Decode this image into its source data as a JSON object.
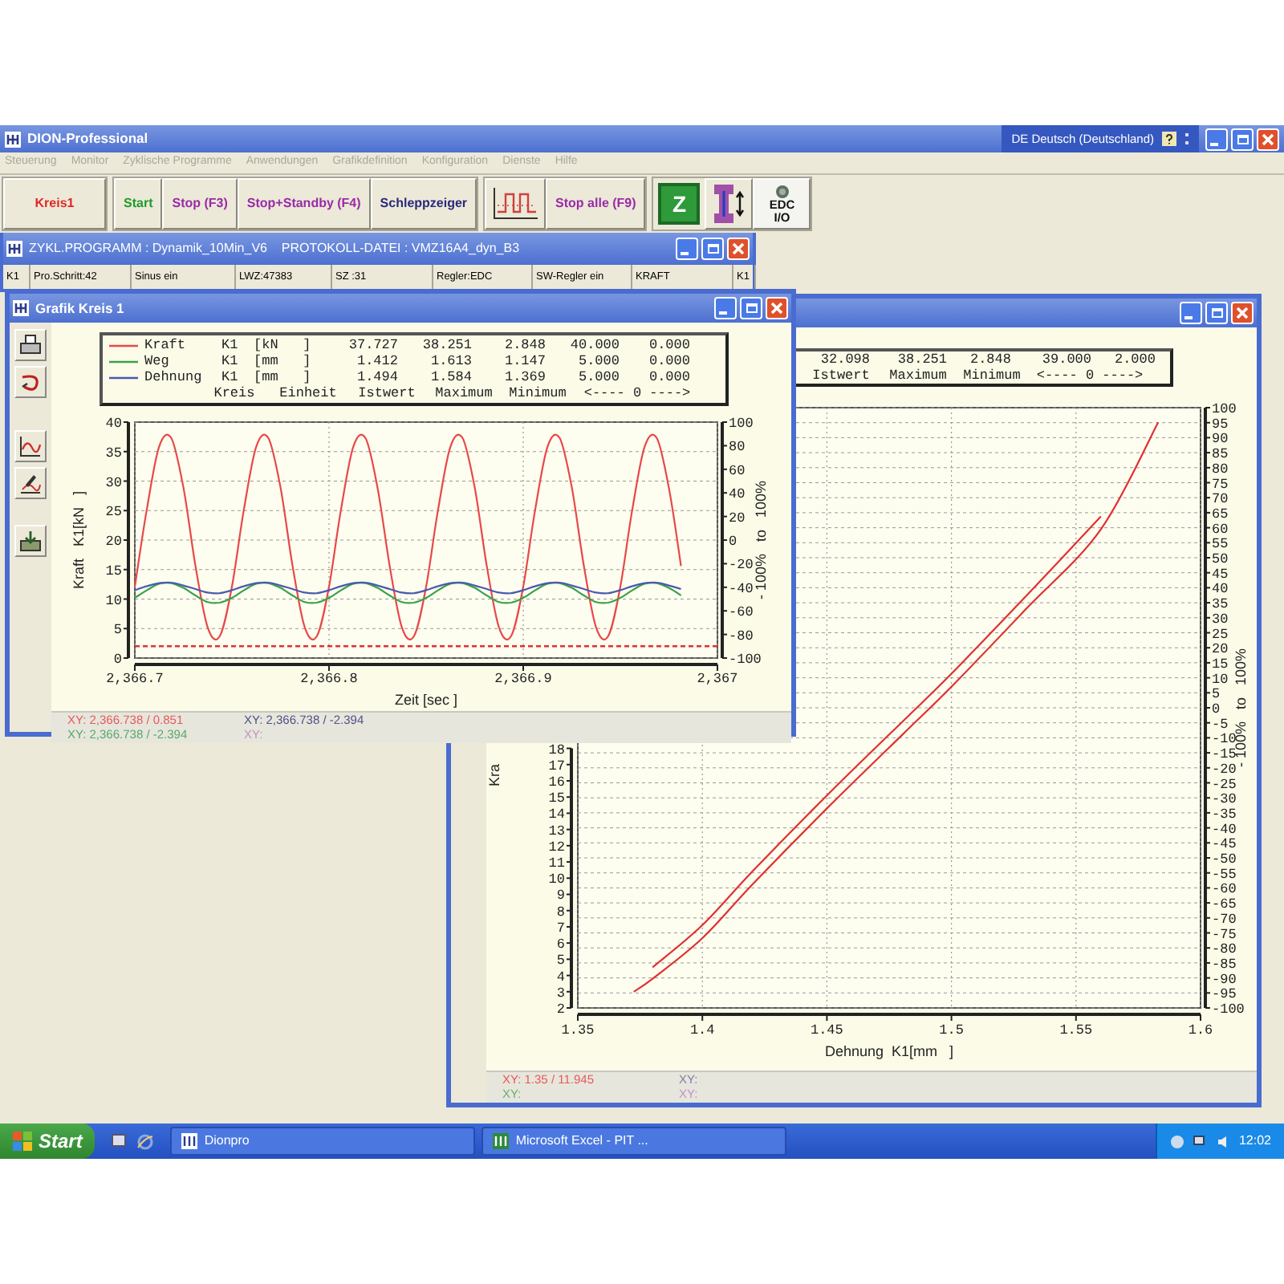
{
  "app": {
    "title": "DION-Professional",
    "language": "DE Deutsch (Deutschland)"
  },
  "menu": [
    "Steuerung",
    "Monitor",
    "Zyklische Programme",
    "Anwendungen",
    "Grafikdefinition",
    "Konfiguration",
    "Dienste",
    "Hilfe"
  ],
  "toolbar": [
    {
      "buttons": [
        {
          "kind": "text",
          "label": "Kreis1",
          "color": "#e02828"
        }
      ]
    },
    {
      "buttons": [
        {
          "kind": "text",
          "label": "Start",
          "color": "#1e9a2e"
        },
        {
          "kind": "text",
          "label": "Stop (F3)",
          "color": "#9a2aa8"
        },
        {
          "kind": "text",
          "label": "Stop+Standby (F4)",
          "color": "#9a2aa8"
        },
        {
          "kind": "text",
          "label": "Schleppzeiger",
          "color": "#2a2a7a"
        }
      ]
    },
    {
      "buttons": [
        {
          "kind": "chart"
        },
        {
          "kind": "text",
          "label": "Stop alle (F9)",
          "color": "#9a2aa8"
        }
      ]
    },
    {
      "buttons": [
        {
          "kind": "tile",
          "label": "Z"
        },
        {
          "kind": "specimen"
        },
        {
          "kind": "io",
          "label": "EDC I/O"
        }
      ]
    }
  ],
  "program_window": {
    "title": "ZYKL.PROGRAMM : Dynamik_10Min_V6    PROTOKOLL-DATEI : VMZ16A4_dyn_B3",
    "cells": [
      "K1",
      "Pro.Schritt:42",
      "Sinus ein",
      "LWZ:47383",
      "SZ :31",
      "Regler:EDC",
      "SW-Regler ein",
      "KRAFT",
      "K1"
    ]
  },
  "grafik_window": {
    "title": "Grafik Kreis 1",
    "legend": {
      "rows": [
        {
          "name": "Kraft",
          "circuit": "K1",
          "unit": "[kN   ]",
          "values": [
            "37.727",
            "38.251",
            "2.848",
            "40.000",
            "0.000"
          ],
          "color": "#e84848"
        },
        {
          "name": "Weg",
          "circuit": "K1",
          "unit": "[mm   ]",
          "values": [
            "1.412",
            "1.613",
            "1.147",
            "5.000",
            "0.000"
          ],
          "color": "#3aa048"
        },
        {
          "name": "Dehnung",
          "circuit": "K1",
          "unit": "[mm   ]",
          "values": [
            "1.494",
            "1.584",
            "1.369",
            "5.000",
            "0.000"
          ],
          "color": "#4a5ab0"
        }
      ],
      "footer": [
        "Kreis",
        "Einheit",
        "Istwert",
        "Maximum",
        "Minimum",
        "<---- 0 ---->"
      ]
    },
    "chart_data": {
      "type": "line",
      "xlabel": "Zeit [sec ]",
      "ylabel": "Kraft   K1[kN   ]",
      "y2label": "- 100%   to   100%",
      "grid": "both",
      "x": [
        2366.7,
        2366.70625,
        2366.7125,
        2366.71875,
        2366.725,
        2366.73125,
        2366.7375,
        2366.74375,
        2366.75,
        2366.75625,
        2366.7625,
        2366.76875,
        2366.775,
        2366.78125,
        2366.7875,
        2366.79375,
        2366.8,
        2366.80625,
        2366.8125,
        2366.81875,
        2366.825,
        2366.83125,
        2366.8375,
        2366.84375,
        2366.85,
        2366.85625,
        2366.8625,
        2366.86875,
        2366.875,
        2366.88125,
        2366.8875,
        2366.89375,
        2366.9,
        2366.90625,
        2366.9125,
        2366.91875,
        2366.925,
        2366.93125,
        2366.9375,
        2366.94375,
        2366.95,
        2366.95625,
        2366.9625,
        2366.96875,
        2366.975,
        2366.98125
      ],
      "series": [
        {
          "color": "#e84848",
          "values": [
            12.1,
            25.4,
            35.8,
            37.3,
            28.9,
            15.6,
            5.2,
            3.7,
            12.1,
            25.4,
            35.8,
            37.3,
            28.9,
            15.6,
            5.2,
            3.7,
            12.1,
            25.4,
            35.8,
            37.3,
            28.9,
            15.6,
            5.2,
            3.7,
            12.1,
            25.4,
            35.8,
            37.3,
            28.9,
            15.6,
            5.2,
            3.7,
            12.1,
            25.4,
            35.8,
            37.3,
            28.9,
            15.6,
            5.2,
            3.7,
            12.1,
            25.4,
            35.8,
            37.3,
            28.9,
            15.6
          ]
        },
        {
          "color": "#3aa048",
          "values": [
            10.2,
            11.5,
            12.6,
            12.7,
            11.9,
            10.6,
            9.5,
            9.4,
            10.2,
            11.5,
            12.6,
            12.7,
            11.9,
            10.6,
            9.5,
            9.4,
            10.2,
            11.5,
            12.6,
            12.7,
            11.9,
            10.6,
            9.5,
            9.4,
            10.2,
            11.5,
            12.6,
            12.7,
            11.9,
            10.6,
            9.5,
            9.4,
            10.2,
            11.5,
            12.6,
            12.7,
            11.9,
            10.6,
            9.5,
            9.4,
            10.2,
            11.5,
            12.6,
            12.7,
            11.9,
            10.6
          ]
        },
        {
          "color": "#4a5ab0",
          "values": [
            11.5,
            12.2,
            12.7,
            12.8,
            12.3,
            11.7,
            11.1,
            11.0,
            11.5,
            12.2,
            12.7,
            12.8,
            12.3,
            11.7,
            11.1,
            11.0,
            11.5,
            12.2,
            12.7,
            12.8,
            12.3,
            11.7,
            11.1,
            11.0,
            11.5,
            12.2,
            12.7,
            12.8,
            12.3,
            11.7,
            11.1,
            11.0,
            11.5,
            12.2,
            12.7,
            12.8,
            12.3,
            11.7,
            11.1,
            11.0,
            11.5,
            12.2,
            12.7,
            12.8,
            12.3,
            11.7
          ]
        }
      ],
      "xlim": [
        2366.7,
        2367
      ],
      "ylim": [
        0,
        40
      ],
      "y2lim": [
        -100,
        100
      ],
      "xticks": [
        {
          "value": 2366.7,
          "label": "2,366.7"
        },
        {
          "value": 2366.8,
          "label": "2,366.8"
        },
        {
          "value": 2366.9,
          "label": "2,366.9"
        },
        {
          "value": 2367,
          "label": "2,367"
        }
      ],
      "yticks": [
        0,
        5,
        10,
        15,
        20,
        25,
        30,
        35,
        40
      ],
      "y2ticks": [
        -100,
        -80,
        -60,
        -40,
        -20,
        0,
        20,
        40,
        60,
        80,
        100
      ],
      "ref_lines": [
        {
          "axis": "y",
          "value": 2,
          "color": "#e03030"
        }
      ]
    },
    "readouts": [
      {
        "text": "XY: 2,366.738 / 0.851",
        "color": "#e85a5a"
      },
      {
        "text": "XY: 2,366.738 / -2.394",
        "color": "#50508a"
      },
      {
        "text": "XY: 2,366.738 / -2.394",
        "color": "#5aa868"
      },
      {
        "text": "XY:",
        "color": "#c890c8"
      }
    ]
  },
  "xy_window": {
    "legend": {
      "values": [
        "32.098",
        "38.251",
        "2.848",
        "39.000",
        "2.000"
      ],
      "footer": [
        "Istwert",
        "Maximum",
        "Minimum",
        "<---- 0 ---->"
      ]
    },
    "chart_data": {
      "type": "line",
      "xlabel": "Dehnung  K1[mm   ]",
      "ylabel": "Kra",
      "y2label": "- 100%   to   100%",
      "grid": "both",
      "x": [
        1.3725,
        1.38,
        1.4,
        1.42,
        1.45,
        1.48,
        1.5,
        1.53,
        1.56,
        1.583
      ],
      "series": [
        {
          "color": "#e03030",
          "values": [
            3.0,
            3.8,
            6.3,
            9.6,
            14.3,
            18.8,
            21.8,
            26.6,
            31.5,
            38.1
          ]
        },
        {
          "color": "#e03030",
          "values": [
            null,
            4.5,
            7.1,
            10.4,
            15.1,
            19.6,
            22.6,
            27.4,
            32.3,
            null
          ]
        }
      ],
      "xlim": [
        1.35,
        1.6
      ],
      "ylim": [
        2,
        39
      ],
      "y2lim": [
        -100,
        100
      ],
      "xticks": [
        {
          "value": 1.35,
          "label": "1.35"
        },
        {
          "value": 1.4,
          "label": "1.4"
        },
        {
          "value": 1.45,
          "label": "1.45"
        },
        {
          "value": 1.5,
          "label": "1.5"
        },
        {
          "value": 1.55,
          "label": "1.55"
        },
        {
          "value": 1.6,
          "label": "1.6"
        }
      ],
      "yticks": [
        2,
        3,
        4,
        5,
        6,
        7,
        8,
        9,
        10,
        11,
        12,
        13,
        14,
        15,
        16,
        17,
        18
      ],
      "y2ticks": [
        -100,
        -95,
        -90,
        -85,
        -80,
        -75,
        -70,
        -65,
        -60,
        -55,
        -50,
        -45,
        -40,
        -35,
        -30,
        -25,
        -20,
        -15,
        -10,
        -5,
        0,
        5,
        10,
        15,
        20,
        25,
        30,
        35,
        40,
        45,
        50,
        55,
        60,
        65,
        70,
        75,
        80,
        85,
        90,
        95,
        100
      ]
    },
    "readouts": [
      {
        "text": "XY: 1.35 / 11.945",
        "color": "#e85a5a"
      },
      {
        "text": "XY:",
        "color": "#8080a8"
      },
      {
        "text": "XY:",
        "color": "#6ab070"
      },
      {
        "text": "XY:",
        "color": "#c890c8"
      }
    ]
  },
  "taskbar": {
    "start": "Start",
    "tasks": [
      "Dionpro",
      "Microsoft Excel - PIT ..."
    ],
    "clock": "12:02"
  }
}
